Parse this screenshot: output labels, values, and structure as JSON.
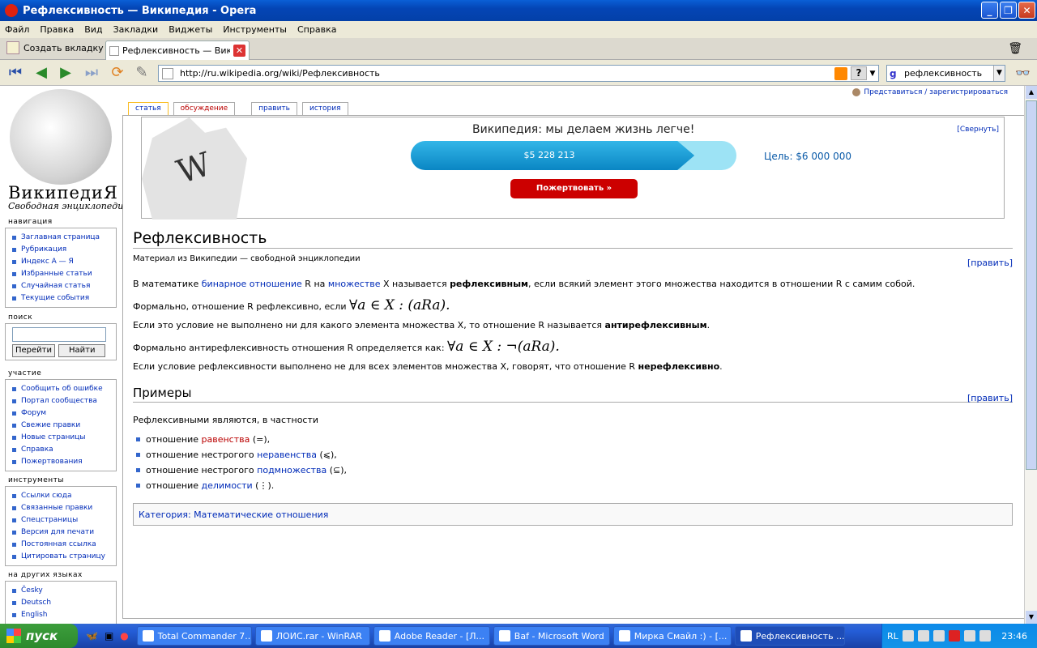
{
  "window": {
    "title": "Рефлексивность — Википедия - Opera"
  },
  "menu": [
    "Файл",
    "Правка",
    "Вид",
    "Закладки",
    "Виджеты",
    "Инструменты",
    "Справка"
  ],
  "tabs": {
    "new_tab": "Создать вкладку",
    "active_tab": "Рефлексивность — Вик..."
  },
  "address": {
    "url": "http://ru.wikipedia.org/wiki/Рефлексивность",
    "search_value": "рефлексивность"
  },
  "wiki": {
    "name": "ВикипедиЯ",
    "slogan": "Свободная энциклопедия",
    "personal": "Представиться / зарегистрироваться",
    "page_tabs": [
      "статья",
      "обсуждение",
      "править",
      "история"
    ],
    "nav_title": "навигация",
    "nav": [
      "Заглавная страница",
      "Рубрикация",
      "Индекс А — Я",
      "Избранные статьи",
      "Случайная статья",
      "Текущие события"
    ],
    "search_title": "поиск",
    "search_go": "Перейти",
    "search_find": "Найти",
    "participation_title": "участие",
    "participation": [
      "Сообщить об ошибке",
      "Портал сообщества",
      "Форум",
      "Свежие правки",
      "Новые страницы",
      "Справка",
      "Пожертвования"
    ],
    "tools_title": "инструменты",
    "tools": [
      "Ссылки сюда",
      "Связанные правки",
      "Спецстраницы",
      "Версия для печати",
      "Постоянная ссылка",
      "Цитировать страницу"
    ],
    "languages_title": "на других языках",
    "languages": [
      "Česky",
      "Deutsch",
      "English"
    ]
  },
  "banner": {
    "slogan": "Википедия: мы делаем жизнь легче!",
    "collapse": "[Свернуть]",
    "raised": "$5 228 213",
    "raised_fraction": 0.871,
    "goal": "Цель: $6 000 000",
    "donate": "Пожертвовать »"
  },
  "article": {
    "title": "Рефлексивность",
    "subtitle": "Материал из Википедии — свободной энциклопедии",
    "edit": "[править]",
    "p1_a": "В математике ",
    "p1_link1": "бинарное отношение",
    "p1_b": " R на ",
    "p1_link2": "множестве",
    "p1_c": " X называется ",
    "p1_bold": "рефлексивным",
    "p1_d": ", если всякий элемент этого множества находится в отношении R с самим собой.",
    "p2": "Формально, отношение R рефлексивно, если ",
    "p2_math": "∀a ∈ X :  (aRa).",
    "p3_a": "Если это условие не выполнено ни для какого элемента множества X, то отношение R называется ",
    "p3_bold": "антирефлексивным",
    "p3_b": ".",
    "p4": "Формально антирефлексивность отношения R определяется как: ",
    "p4_math": "∀a ∈ X :  ¬(aRa).",
    "p5_a": "Если условие рефлексивности выполнено не для всех элементов множества X, говорят, что отношение R ",
    "p5_bold": "нерефлексивно",
    "p5_b": ".",
    "examples_title": "Примеры",
    "examples_intro": "Рефлексивными являются, в частности",
    "ex1_a": "отношение ",
    "ex1_link": "равенства",
    "ex1_b": " (=),",
    "ex2_a": "отношение нестрогого ",
    "ex2_link": "неравенства",
    "ex2_b": " (⩽),",
    "ex3_a": "отношение нестрогого ",
    "ex3_link": "подмножества",
    "ex3_b": " (⊆),",
    "ex4_a": "отношение ",
    "ex4_link": "делимости",
    "ex4_b": " (⋮).",
    "categories": "Категория: Математические отношения"
  },
  "taskbar": {
    "start": "пуск",
    "tasks": [
      "Total Commander 7....",
      "ЛОИС.rar - WinRAR",
      "Adobe Reader - [Л...",
      "Baf - Microsoft Word",
      "Мирка Смайл :) - [...",
      "Рефлексивность ..."
    ],
    "lang": "RL",
    "clock": "23:46"
  }
}
